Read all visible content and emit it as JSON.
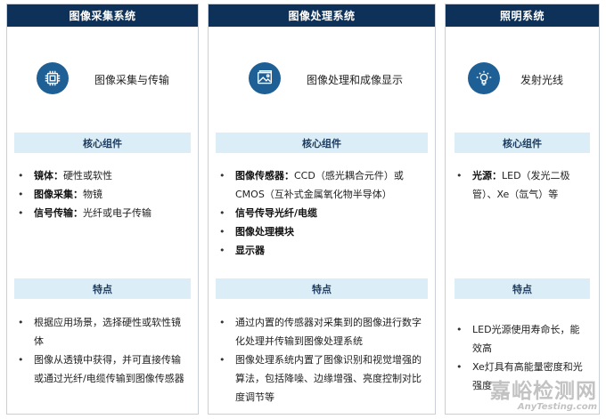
{
  "columns": [
    {
      "header": "图像采集系统",
      "icon": "chip-icon",
      "title": "图像采集与传输",
      "components_label": "核心组件",
      "components": [
        {
          "bold": "镜体：",
          "text": "硬性或软性"
        },
        {
          "bold": "图像采集：",
          "text": "物镜"
        },
        {
          "bold": "信号传输：",
          "text": "光纤或电子传输"
        }
      ],
      "features_label": "特点",
      "features": [
        "根据应用场景，选择硬性或软性镜体",
        "图像从透镜中获得，并可直接传输或通过光纤/电缆传输到图像传感器"
      ]
    },
    {
      "header": "图像处理系统",
      "icon": "image-icon",
      "title": "图像处理和成像显示",
      "components_label": "核心组件",
      "components": [
        {
          "bold": "图像传感器：",
          "text": "CCD（感光耦合元件）或CMOS（互补式金属氧化物半导体）"
        },
        {
          "bold": "信号传导光纤/电缆",
          "text": ""
        },
        {
          "bold": "图像处理模块",
          "text": ""
        },
        {
          "bold": "显示器",
          "text": ""
        }
      ],
      "features_label": "特点",
      "features": [
        "通过内置的传感器对采集到的图像进行数字化处理并传输到图像处理系统",
        "图像处理系统内置了图像识别和视觉增强的算法，包括降噪、边缘增强、亮度控制对比度调节等"
      ]
    },
    {
      "header": "照明系统",
      "icon": "light-bulb-icon",
      "title": "发射光线",
      "components_label": "核心组件",
      "components": [
        {
          "bold": "光源：",
          "text": "LED（发光二极管）、Xe（氙气）等"
        }
      ],
      "features_label": "特点",
      "features": [
        "LED光源使用寿命长，能效高",
        "Xe灯具有高能量密度和光强度"
      ]
    }
  ],
  "watermark": {
    "cn": "嘉峪检测网",
    "en": "AnyTesting.com"
  },
  "colors": {
    "header": "#0d3158",
    "icon": "#1e5f96",
    "band": "#dbeef8"
  }
}
